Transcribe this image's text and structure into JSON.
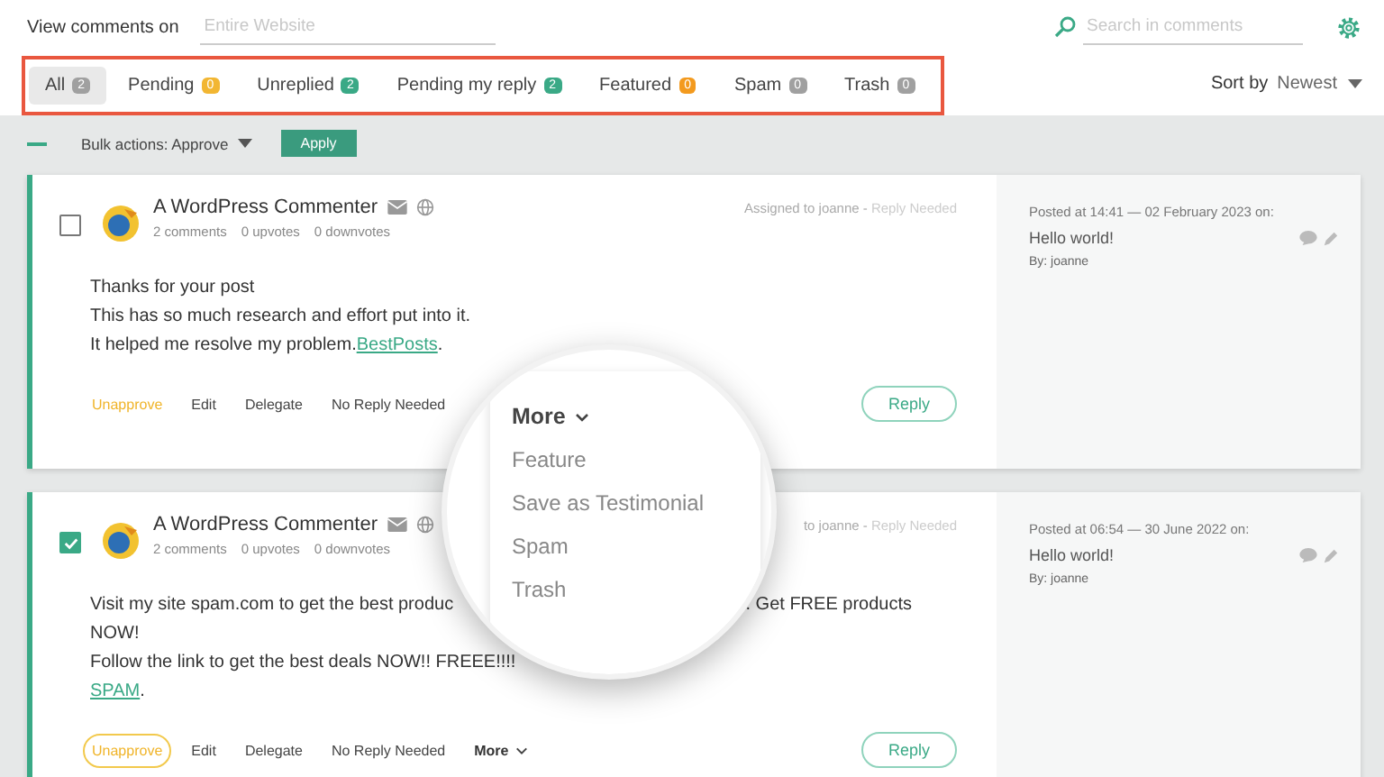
{
  "filter": {
    "label": "View comments on",
    "placeholder": "Entire Website"
  },
  "search": {
    "placeholder": "Search in comments"
  },
  "tabs": [
    {
      "label": "All",
      "count": "2",
      "color": "#a0a0a0",
      "selected": true
    },
    {
      "label": "Pending",
      "count": "0",
      "color": "#f2b632",
      "selected": false
    },
    {
      "label": "Unreplied",
      "count": "2",
      "color": "#3aa986",
      "selected": false
    },
    {
      "label": "Pending my reply",
      "count": "2",
      "color": "#3aa986",
      "selected": false
    },
    {
      "label": "Featured",
      "count": "0",
      "color": "#f39a1e",
      "selected": false
    },
    {
      "label": "Spam",
      "count": "0",
      "color": "#a0a0a0",
      "selected": false
    },
    {
      "label": "Trash",
      "count": "0",
      "color": "#a0a0a0",
      "selected": false
    }
  ],
  "sort": {
    "label": "Sort by",
    "value": "Newest"
  },
  "bulk": {
    "label": "Bulk actions: Approve",
    "button": "Apply"
  },
  "comments": [
    {
      "checked": false,
      "author": "A WordPress Commenter",
      "stats": [
        "2 comments",
        "0 upvotes",
        "0 downvotes"
      ],
      "assigned": "Assigned to joanne - ",
      "status": "Reply Needed",
      "lines": [
        {
          "split": false,
          "parts": [
            {
              "kind": "text",
              "text": "Thanks for your post"
            }
          ]
        },
        {
          "split": false,
          "parts": [
            {
              "kind": "text",
              "text": "This has so much research and effort put into it."
            }
          ]
        },
        {
          "split": false,
          "parts": [
            {
              "kind": "text",
              "text": "It helped me resolve my problem."
            },
            {
              "kind": "link",
              "text": "BestPosts"
            },
            {
              "kind": "text",
              "text": "."
            }
          ]
        }
      ],
      "actions": [
        {
          "kind": "unapprove",
          "label": "Unapprove",
          "outlined": false
        },
        {
          "kind": "plain",
          "label": "Edit",
          "outlined": false
        },
        {
          "kind": "plain",
          "label": "Delegate",
          "outlined": false
        },
        {
          "kind": "plain",
          "label": "No Reply Needed",
          "outlined": false
        }
      ],
      "reply": "Reply",
      "posted": "Posted at 14:41 — 02 February 2023 on:",
      "post": "Hello world!",
      "by": "By: joanne"
    },
    {
      "checked": true,
      "author": "A WordPress Commenter",
      "stats": [
        "2 comments",
        "0 upvotes",
        "0 downvotes"
      ],
      "assigned": "to joanne - ",
      "status": "Reply Needed",
      "lines": [
        {
          "split": true,
          "parts": [
            {
              "kind": "text",
              "text": "Visit my site spam.com to get the best produc"
            },
            {
              "kind": "text",
              "text": ". Get FREE products"
            }
          ]
        },
        {
          "split": false,
          "parts": [
            {
              "kind": "text",
              "text": "NOW!"
            }
          ]
        },
        {
          "split": false,
          "parts": [
            {
              "kind": "text",
              "text": "Follow the link to get the best deals NOW!! FREEE!!!!"
            }
          ]
        },
        {
          "split": false,
          "parts": [
            {
              "kind": "link",
              "text": "SPAM"
            },
            {
              "kind": "text",
              "text": "."
            }
          ]
        }
      ],
      "actions": [
        {
          "kind": "unapprove",
          "label": "Unapprove",
          "outlined": true
        },
        {
          "kind": "plain",
          "label": "Edit",
          "outlined": false
        },
        {
          "kind": "plain",
          "label": "Delegate",
          "outlined": false
        },
        {
          "kind": "plain",
          "label": "No Reply Needed",
          "outlined": false
        },
        {
          "kind": "more",
          "label": "More",
          "outlined": false
        }
      ],
      "reply": "Reply",
      "posted": "Posted at 06:54 — 30 June 2022 on:",
      "post": "Hello world!",
      "by": "By: joanne"
    }
  ],
  "magnifier": {
    "title": "More",
    "items": [
      "Feature",
      "Save as Testimonial",
      "Spam",
      "Trash"
    ]
  }
}
